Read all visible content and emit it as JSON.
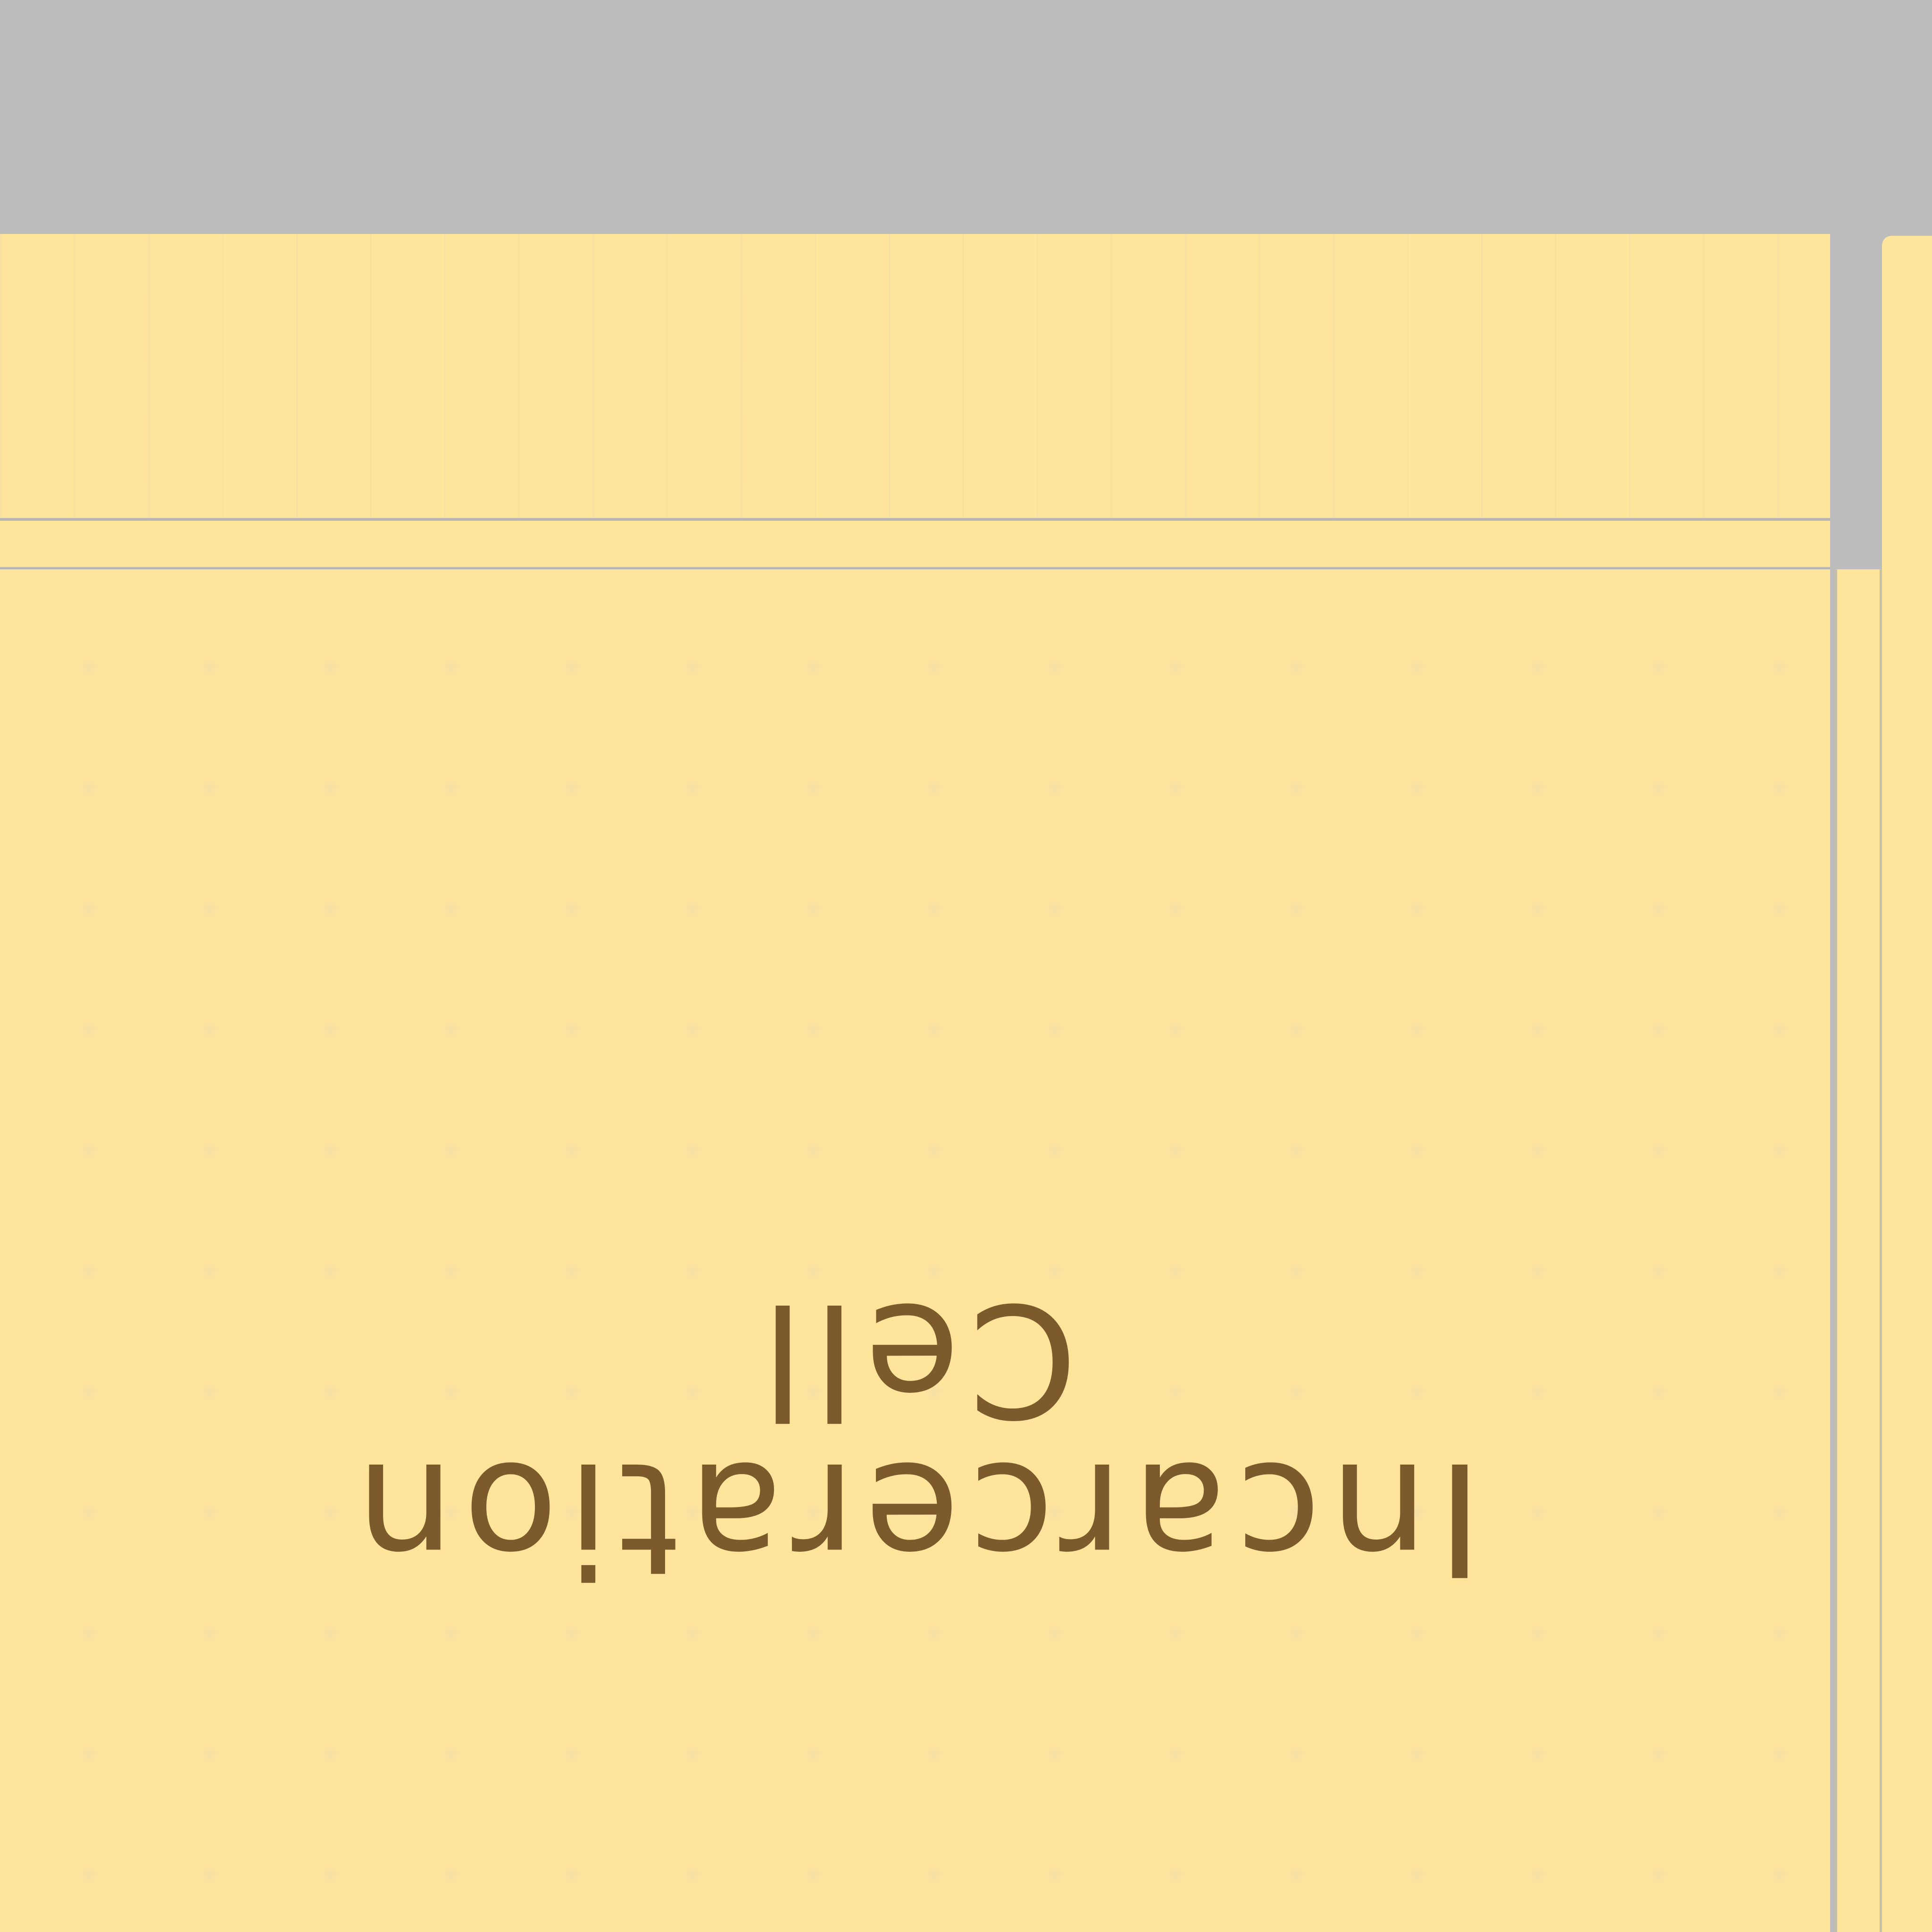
{
  "room": {
    "label_line_1": "Incarceration",
    "label_line_2": "Cell",
    "floor_color": "#ffe49c",
    "wall_color": "#bcbcbc",
    "text_color": "#7d5a2c",
    "orientation": "upside-down"
  }
}
